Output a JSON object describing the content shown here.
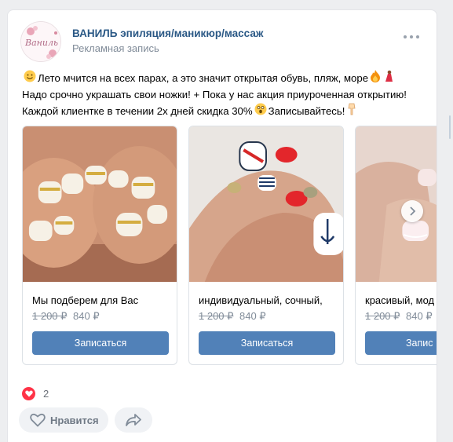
{
  "post": {
    "author": "ВАНИЛЬ эпиляция/маникюр/массаж",
    "ad_label": "Рекламная запись",
    "avatar_text": "Ваниль",
    "text_lines": [
      "Лето мчится на всех парах, а это значит открытая обувь, пляж, море",
      "Надо срочно украшать свои ножки! + Пока у нас акция приуроченная открытию!",
      "Каждой клиентке в течении 2х дней скидка 30%",
      "Записывайтесь!"
    ]
  },
  "carousel": {
    "cards": [
      {
        "title": "Мы подберем для Вас",
        "old_price": "1 200 ₽",
        "new_price": "840 ₽",
        "button": "Записаться"
      },
      {
        "title": "индивидуальный, сочный,",
        "old_price": "1 200 ₽",
        "new_price": "840 ₽",
        "button": "Записаться"
      },
      {
        "title": "красивый, мод",
        "old_price": "1 200 ₽",
        "new_price": "840 ₽",
        "button": "Запис"
      }
    ]
  },
  "reactions": {
    "likes_count": "2"
  },
  "actions": {
    "like_label": "Нравится"
  },
  "colors": {
    "accent": "#5181b8",
    "link": "#2a5885",
    "like": "#ff3347"
  }
}
